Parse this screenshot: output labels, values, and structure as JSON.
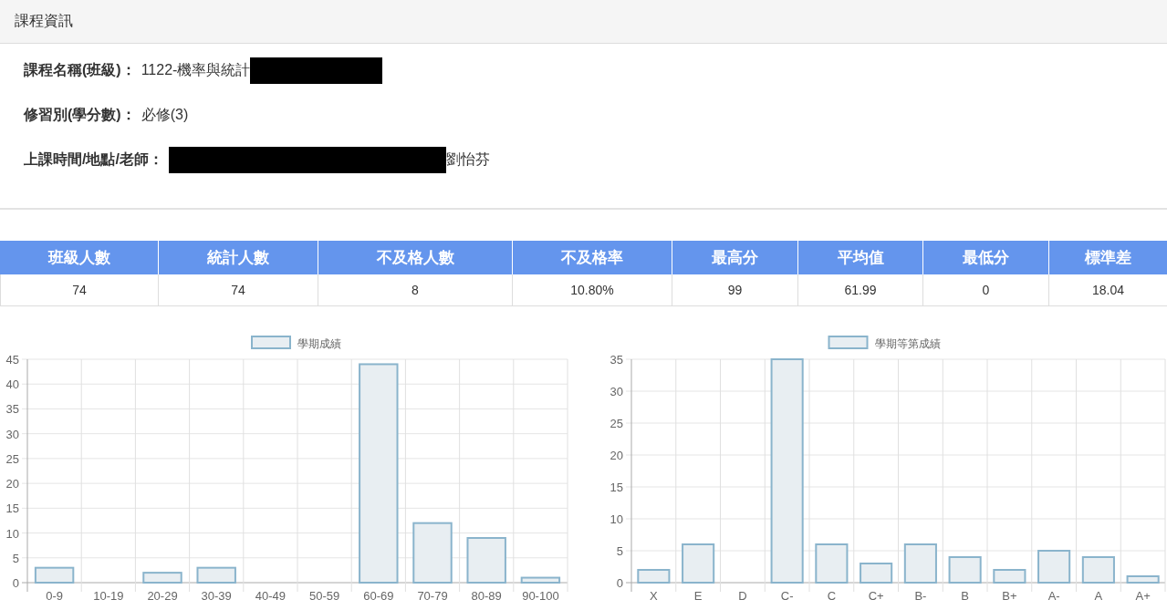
{
  "panel": {
    "title": "課程資訊"
  },
  "info": [
    {
      "label": "課程名稱(班級)：",
      "parts": [
        {
          "kind": "text",
          "text": "1122-機率與統計"
        },
        {
          "kind": "redaction"
        }
      ]
    },
    {
      "label": "修習別(學分數)：",
      "parts": [
        {
          "kind": "text",
          "text": "必修(3)"
        }
      ]
    },
    {
      "label": "上課時間/地點/老師：",
      "parts": [
        {
          "kind": "redaction"
        },
        {
          "kind": "text",
          "text": "劉怡芬"
        }
      ]
    }
  ],
  "stats": {
    "columns": [
      "班級人數",
      "統計人數",
      "不及格人數",
      "不及格率",
      "最高分",
      "平均值",
      "最低分",
      "標準差"
    ],
    "rows": [
      [
        "74",
        "74",
        "8",
        "10.80%",
        "99",
        "61.99",
        "0",
        "18.04"
      ]
    ]
  },
  "charts": [
    {
      "chart_data": {
        "type": "bar",
        "categories": [
          "0-9",
          "10-19",
          "20-29",
          "30-39",
          "40-49",
          "50-59",
          "60-69",
          "70-79",
          "80-89",
          "90-100"
        ],
        "series": [
          {
            "name": "學期成績",
            "color": "#8ab4cc",
            "values": [
              3,
              0,
              2,
              3,
              0,
              0,
              44,
              12,
              9,
              1
            ]
          }
        ],
        "ylim": [
          0,
          45
        ],
        "grid": true,
        "yticks": [
          0,
          5,
          10,
          15,
          20,
          25,
          30,
          35,
          40,
          45
        ]
      }
    },
    {
      "chart_data": {
        "type": "bar",
        "categories": [
          "X",
          "E",
          "D",
          "C-",
          "C",
          "C+",
          "B-",
          "B",
          "B+",
          "A-",
          "A",
          "A+"
        ],
        "series": [
          {
            "name": "學期等第成績",
            "color": "#8ab4cc",
            "values": [
              2,
              6,
              0,
              35,
              6,
              3,
              6,
              4,
              2,
              5,
              4,
              1
            ]
          }
        ],
        "ylim": [
          0,
          35
        ],
        "grid": true,
        "yticks": [
          0,
          5,
          10,
          15,
          20,
          25,
          30,
          35
        ]
      }
    }
  ]
}
